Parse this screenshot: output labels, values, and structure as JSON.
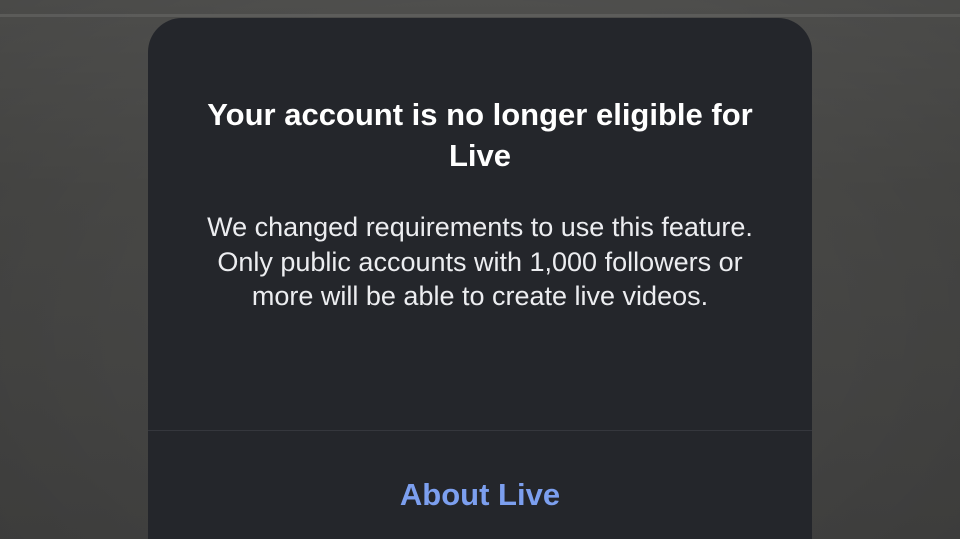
{
  "dialog": {
    "title": "Your account is no longer eligible for Live",
    "message": "We changed requirements to use this feature. Only public accounts with 1,000 followers or more will be able to create live videos.",
    "action_label": "About Live"
  },
  "colors": {
    "dialog_background": "#24262b",
    "title_text": "#ffffff",
    "message_text": "#ecedf0",
    "action_text": "#7c9fef",
    "divider": "#35373d"
  }
}
